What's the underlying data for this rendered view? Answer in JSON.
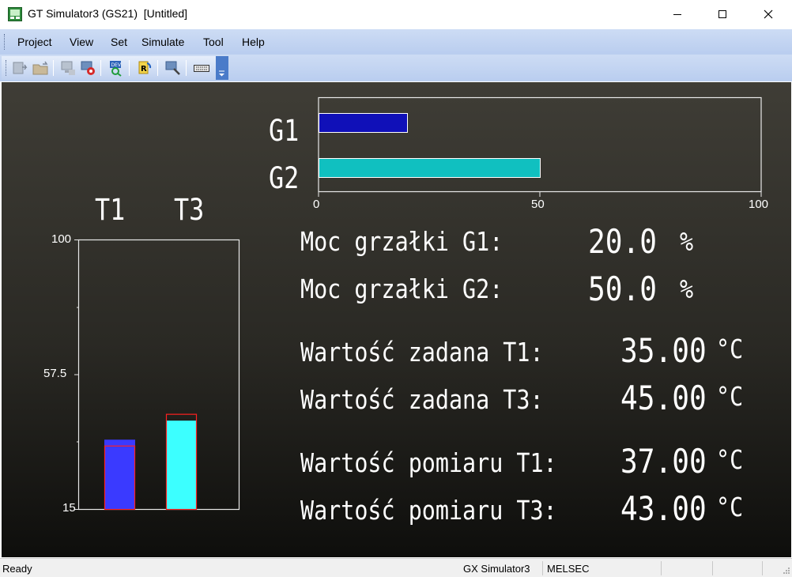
{
  "window": {
    "title": "GT Simulator3 (GS21)  [Untitled]"
  },
  "menu": {
    "items": [
      "Project",
      "View",
      "Set",
      "Simulate",
      "Tool",
      "Help"
    ]
  },
  "hbar_chart": {
    "categories": [
      "G1",
      "G2"
    ],
    "values": [
      20,
      50
    ],
    "colors": [
      "#1010b8",
      "#10c0c0"
    ],
    "xlim": [
      0,
      100
    ],
    "ticks": [
      "0",
      "50",
      "100"
    ]
  },
  "vbar_chart": {
    "categories": [
      "T1",
      "T3"
    ],
    "setpoint": [
      35,
      45
    ],
    "measured": [
      37,
      43
    ],
    "colors": [
      "#3a3aff",
      "#3cffff"
    ],
    "outline": "#ff2020",
    "ylim": [
      15,
      100
    ],
    "ticks": [
      "100",
      "57.5",
      "15"
    ]
  },
  "readouts": {
    "g1_label": "Moc grzałki G1:",
    "g1_value": "20.0",
    "g1_unit": "%",
    "g2_label": "Moc grzałki G2:",
    "g2_value": "50.0",
    "g2_unit": "%",
    "set_t1_label": "Wartość zadana T1:",
    "set_t1_value": "35.00",
    "set_t1_unit": "°C",
    "set_t3_label": "Wartość zadana T3:",
    "set_t3_value": "45.00",
    "set_t3_unit": "°C",
    "meas_t1_label": "Wartość pomiaru T1:",
    "meas_t1_value": "37.00",
    "meas_t1_unit": "°C",
    "meas_t3_label": "Wartość pomiaru T3:",
    "meas_t3_value": "43.00",
    "meas_t3_unit": "°C"
  },
  "status": {
    "left": "Ready",
    "sim": "GX Simulator3",
    "plc": "MELSEC"
  }
}
